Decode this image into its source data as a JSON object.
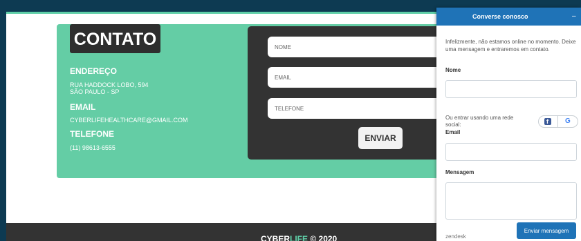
{
  "contact": {
    "title": "CONTATO",
    "address_heading": "ENDEREÇO",
    "address_line1": "RUA HADDOCK LOBO, 594",
    "address_line2": "SÃO PAULO - SP",
    "email_heading": "EMAIL",
    "email_value": "CYBERLIFEHEALTHCARE@GMAIL.COM",
    "phone_heading": "TELEFONE",
    "phone_value": "(11) 98613-6555"
  },
  "form": {
    "name_placeholder": "NOME",
    "email_placeholder": "EMAIL",
    "phone_placeholder": "TELEFONE",
    "submit_label": "ENVIAR"
  },
  "footer": {
    "brand_part1": "CYBER",
    "brand_part2": "LIFE",
    "brand_suffix": " © 2020"
  },
  "chat": {
    "title": "Converse conosco",
    "minimize_glyph": "–",
    "notice": "Infelizmente, não estamos online no momento. Deixe uma mensagem e entraremos em contato.",
    "name_label": "Nome",
    "social_text": "Ou entrar usando uma rede social:",
    "facebook_glyph": "f",
    "google_glyph": "G",
    "email_label": "Email",
    "message_label": "Mensagem",
    "branding": "zendesk",
    "send_label": "Enviar mensagem"
  },
  "colors": {
    "background": "#0d3a52",
    "accent_teal": "#64cda5",
    "dark_box": "#333333",
    "chat_blue": "#1f73b7"
  }
}
